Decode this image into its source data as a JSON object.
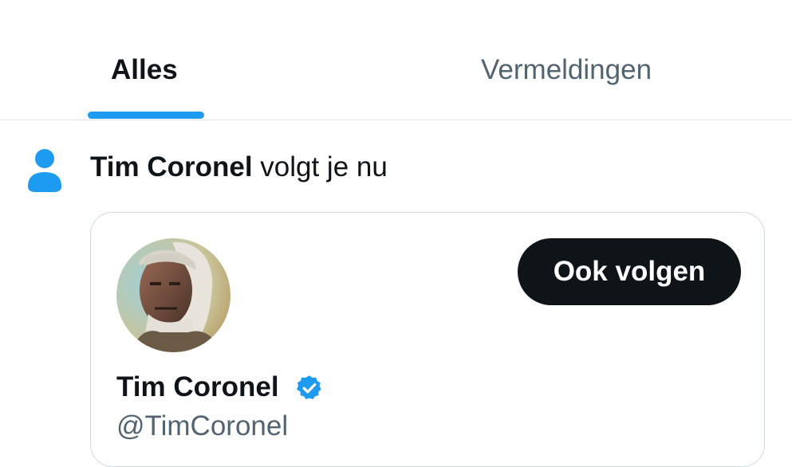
{
  "tabs": [
    {
      "label": "Alles",
      "active": true
    },
    {
      "label": "Vermeldingen",
      "active": false
    }
  ],
  "notification": {
    "icon": "person-icon",
    "actor_name": "Tim Coronel",
    "action_text": " volgt je nu"
  },
  "profile_card": {
    "name": "Tim Coronel",
    "handle": "@TimCoronel",
    "verified": true,
    "follow_button_label": "Ook volgen"
  },
  "colors": {
    "accent": "#1d9bf0",
    "text_primary": "#0f1419",
    "text_secondary": "#536471",
    "button_bg": "#0f1419"
  }
}
